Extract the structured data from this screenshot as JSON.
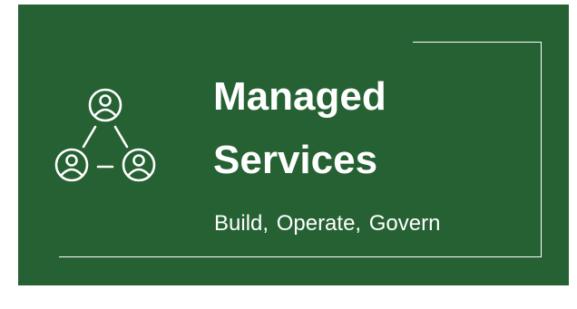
{
  "banner": {
    "title_line1": "Managed",
    "title_line2": "Services",
    "subtitle": "Build, Operate, Govern",
    "icon": "user-network-icon",
    "colors": {
      "background": "#256132",
      "foreground": "#ffffff"
    }
  }
}
